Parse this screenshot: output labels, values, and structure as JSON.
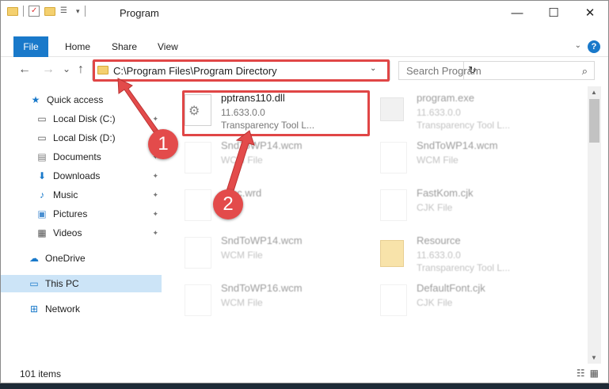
{
  "window": {
    "title": "Program",
    "controls": {
      "minimize": "—",
      "maximize": "☐",
      "close": "✕"
    }
  },
  "ribbon": {
    "tabs": [
      "File",
      "Home",
      "Share",
      "View"
    ],
    "help": "?"
  },
  "nav": {
    "back": "←",
    "forward": "→",
    "recent": "⌄",
    "up": "↑",
    "address": "C:\\Program Files\\Program Directory",
    "refresh": "↻",
    "search_placeholder": "Search Program"
  },
  "sidebar": {
    "items": [
      {
        "label": "Quick access",
        "icon": "star-icon",
        "glyph": "★",
        "color": "#1979ca"
      },
      {
        "label": "Local Disk (C:)",
        "icon": "drive-icon",
        "glyph": "▭",
        "color": "#555555",
        "pinned": true
      },
      {
        "label": "Local Disk (D:)",
        "icon": "drive-icon",
        "glyph": "▭",
        "color": "#555555",
        "pinned": true
      },
      {
        "label": "Documents",
        "icon": "documents-icon",
        "glyph": "▤",
        "color": "#7a7a7a",
        "pinned": true
      },
      {
        "label": "Downloads",
        "icon": "downloads-icon",
        "glyph": "⬇",
        "color": "#1979ca",
        "pinned": true
      },
      {
        "label": "Music",
        "icon": "music-icon",
        "glyph": "♪",
        "color": "#1979ca",
        "pinned": true
      },
      {
        "label": "Pictures",
        "icon": "pictures-icon",
        "glyph": "▣",
        "color": "#4a8fd1",
        "pinned": true
      },
      {
        "label": "Videos",
        "icon": "videos-icon",
        "glyph": "▦",
        "color": "#555555",
        "pinned": true
      },
      {
        "label": "OneDrive",
        "icon": "cloud-icon",
        "glyph": "☁",
        "color": "#1979ca"
      },
      {
        "label": "This PC",
        "icon": "computer-icon",
        "glyph": "▭",
        "color": "#1979ca",
        "selected": true
      },
      {
        "label": "Network",
        "icon": "network-icon",
        "glyph": "⊞",
        "color": "#1979ca"
      }
    ],
    "pin_glyph": "📌"
  },
  "files": [
    {
      "name": "pptrans110.dll",
      "line1": "11.633.0.0",
      "line2": "Transparency Tool L...",
      "type": "dll",
      "faded": false
    },
    {
      "name": "program.exe",
      "line1": "11.633.0.0",
      "line2": "Transparency Tool L...",
      "type": "exe",
      "faded": true
    },
    {
      "name": "SndToWP14.wcm",
      "line1": "WCM File",
      "line2": "",
      "type": "doc",
      "faded": true
    },
    {
      "name": "SndToWP14.wcm",
      "line1": "WCM File",
      "line2": "",
      "type": "doc",
      "faded": true
    },
    {
      "name": "misc.wrd",
      "line1": "File",
      "line2": "",
      "type": "doc",
      "faded": true
    },
    {
      "name": "FastKom.cjk",
      "line1": "CJK File",
      "line2": "",
      "type": "doc",
      "faded": true
    },
    {
      "name": "SndToWP14.wcm",
      "line1": "WCM File",
      "line2": "",
      "type": "doc",
      "faded": true
    },
    {
      "name": "Resource",
      "line1": "11.633.0.0",
      "line2": "Transparency Tool L...",
      "type": "folder",
      "faded": true
    },
    {
      "name": "SndToWP16.wcm",
      "line1": "WCM File",
      "line2": "",
      "type": "doc",
      "faded": true
    },
    {
      "name": "DefaultFont.cjk",
      "line1": "CJK File",
      "line2": "",
      "type": "doc",
      "faded": true
    }
  ],
  "status": {
    "count": "101 items"
  },
  "annotations": {
    "badge1": "1",
    "badge2": "2",
    "accent": "#e04646"
  }
}
